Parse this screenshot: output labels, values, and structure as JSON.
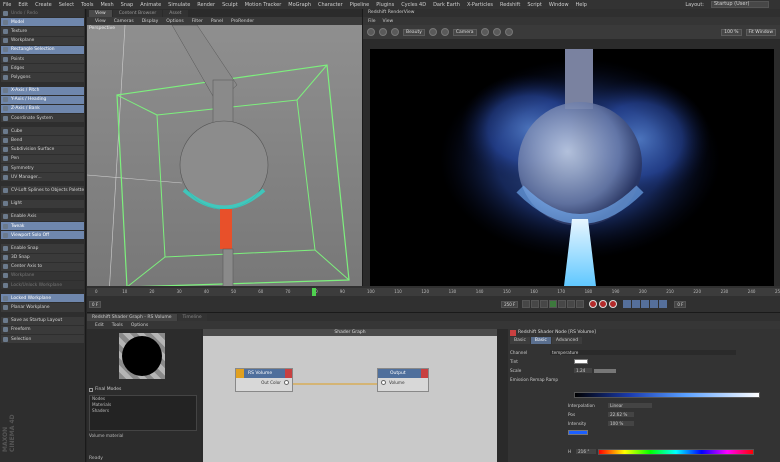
{
  "menubar": {
    "items": [
      "File",
      "Edit",
      "Create",
      "Select",
      "Tools",
      "Mesh",
      "Snap",
      "Animate",
      "Simulate",
      "Render",
      "Sculpt",
      "Motion Tracker",
      "MoGraph",
      "Character",
      "Pipeline",
      "Plugins",
      "Cycles 4D",
      "Dark Earth",
      "X-Particles",
      "Redshift",
      "Script",
      "Window",
      "Help"
    ],
    "layout_label": "Layout:",
    "layout_value": "Startup (User)"
  },
  "left_palette": {
    "items": [
      {
        "label": "Undo / Redo",
        "state": "dim"
      },
      {
        "label": "Model",
        "state": "act"
      },
      {
        "label": "Texture",
        "state": ""
      },
      {
        "label": "Workplane",
        "state": ""
      },
      {
        "label": "Rectangle Selection",
        "state": "act"
      },
      {
        "label": "Points",
        "state": ""
      },
      {
        "label": "Edges",
        "state": ""
      },
      {
        "label": "Polygons",
        "state": ""
      },
      {
        "label": "",
        "state": "gap"
      },
      {
        "label": "X-Axis / Pitch",
        "state": "act"
      },
      {
        "label": "Y-Axis / Heading",
        "state": "act"
      },
      {
        "label": "Z-Axis / Bank",
        "state": "act"
      },
      {
        "label": "Coordinate System",
        "state": ""
      },
      {
        "label": "",
        "state": "gap"
      },
      {
        "label": "Cube",
        "state": ""
      },
      {
        "label": "Bend",
        "state": ""
      },
      {
        "label": "Subdivision Surface",
        "state": ""
      },
      {
        "label": "Pen",
        "state": ""
      },
      {
        "label": "Symmetry",
        "state": ""
      },
      {
        "label": "UV Manager...",
        "state": ""
      },
      {
        "label": "",
        "state": "gap"
      },
      {
        "label": "CV-Loft Splines to Objects Palette",
        "state": ""
      },
      {
        "label": "",
        "state": "gap"
      },
      {
        "label": "Light",
        "state": ""
      },
      {
        "label": "",
        "state": "gap"
      },
      {
        "label": "Enable Axis",
        "state": ""
      },
      {
        "label": "Tweak",
        "state": "act"
      },
      {
        "label": "Viewport Solo Off",
        "state": "act"
      },
      {
        "label": "",
        "state": "gap"
      },
      {
        "label": "Enable Snap",
        "state": ""
      },
      {
        "label": "3D Snap",
        "state": ""
      },
      {
        "label": "Center Axis to",
        "state": ""
      },
      {
        "label": "Workplane",
        "state": "dim"
      },
      {
        "label": "Lock/Unlock Workplane",
        "state": "dim"
      },
      {
        "label": "",
        "state": "gap"
      },
      {
        "label": "Locked Workplane",
        "state": "act"
      },
      {
        "label": "Planar Workplane",
        "state": ""
      },
      {
        "label": "",
        "state": "gap"
      },
      {
        "label": "Save as Startup Layout",
        "state": ""
      },
      {
        "label": "Freeform",
        "state": ""
      },
      {
        "label": "Selection",
        "state": ""
      }
    ],
    "logo": "MAXON CINEMA 4D"
  },
  "viewport": {
    "tabs": [
      "View",
      "Content Browser",
      "Asset"
    ],
    "menu": [
      "View",
      "Cameras",
      "Display",
      "Options",
      "Filter",
      "Panel",
      "ProRender"
    ],
    "label": "Perspective",
    "grid_spacing": "Grid Spacing : 10 cm"
  },
  "timeline": {
    "ticks": [
      "0",
      "10",
      "20",
      "30",
      "40",
      "50",
      "60",
      "70",
      "80",
      "90",
      "100",
      "110",
      "120",
      "130",
      "140",
      "150",
      "160",
      "170",
      "180",
      "190",
      "200",
      "210",
      "220",
      "230",
      "240",
      "250"
    ],
    "start_frame": "0 F",
    "end_frame": "250 F",
    "current_frame": "0 F"
  },
  "renderview": {
    "title": "Redshift RenderView",
    "menu": [
      "File",
      "View"
    ],
    "beauty": "Beauty",
    "camera": "Camera",
    "zoom": "100 %",
    "window": "Fit Window"
  },
  "shader": {
    "tabs": [
      {
        "label": "Redshift Shader Graph - RS Volume",
        "state": "act"
      },
      {
        "label": "Timeline",
        "state": "dim"
      }
    ],
    "menu": [
      "Edit",
      "Tools",
      "Options"
    ],
    "final_modes_label": "Final Modes",
    "nodes_header": "Nodes",
    "nodes": [
      "Materials",
      "Shaders"
    ],
    "volume_material": "Volume material",
    "status": "Ready",
    "graph_title": "Shader Graph",
    "node_rs_volume": {
      "title": "RS Volume",
      "port": "Out Color"
    },
    "node_output": {
      "title": "Output",
      "port": "Volume"
    }
  },
  "attributes": {
    "title": "Redshift Shader Node [RS Volume]",
    "tabs": [
      {
        "label": "Basic",
        "state": ""
      },
      {
        "label": "Basic",
        "state": "act"
      },
      {
        "label": "Advanced",
        "state": ""
      }
    ],
    "channel_label": "Channel",
    "channel_value": "temperature",
    "tint_label": "Tint",
    "scale_label": "Scale",
    "scale_value": "1.24",
    "remap_label": "Emission Remap Ramp",
    "interp_label": "Interpolation",
    "interp_value": "Linear",
    "pos_label": "Pos",
    "pos_value": "22.62 %",
    "intensity_label": "Intensity",
    "intensity_value": "100 %",
    "hue_label": "H",
    "hue_value": "216 °"
  }
}
